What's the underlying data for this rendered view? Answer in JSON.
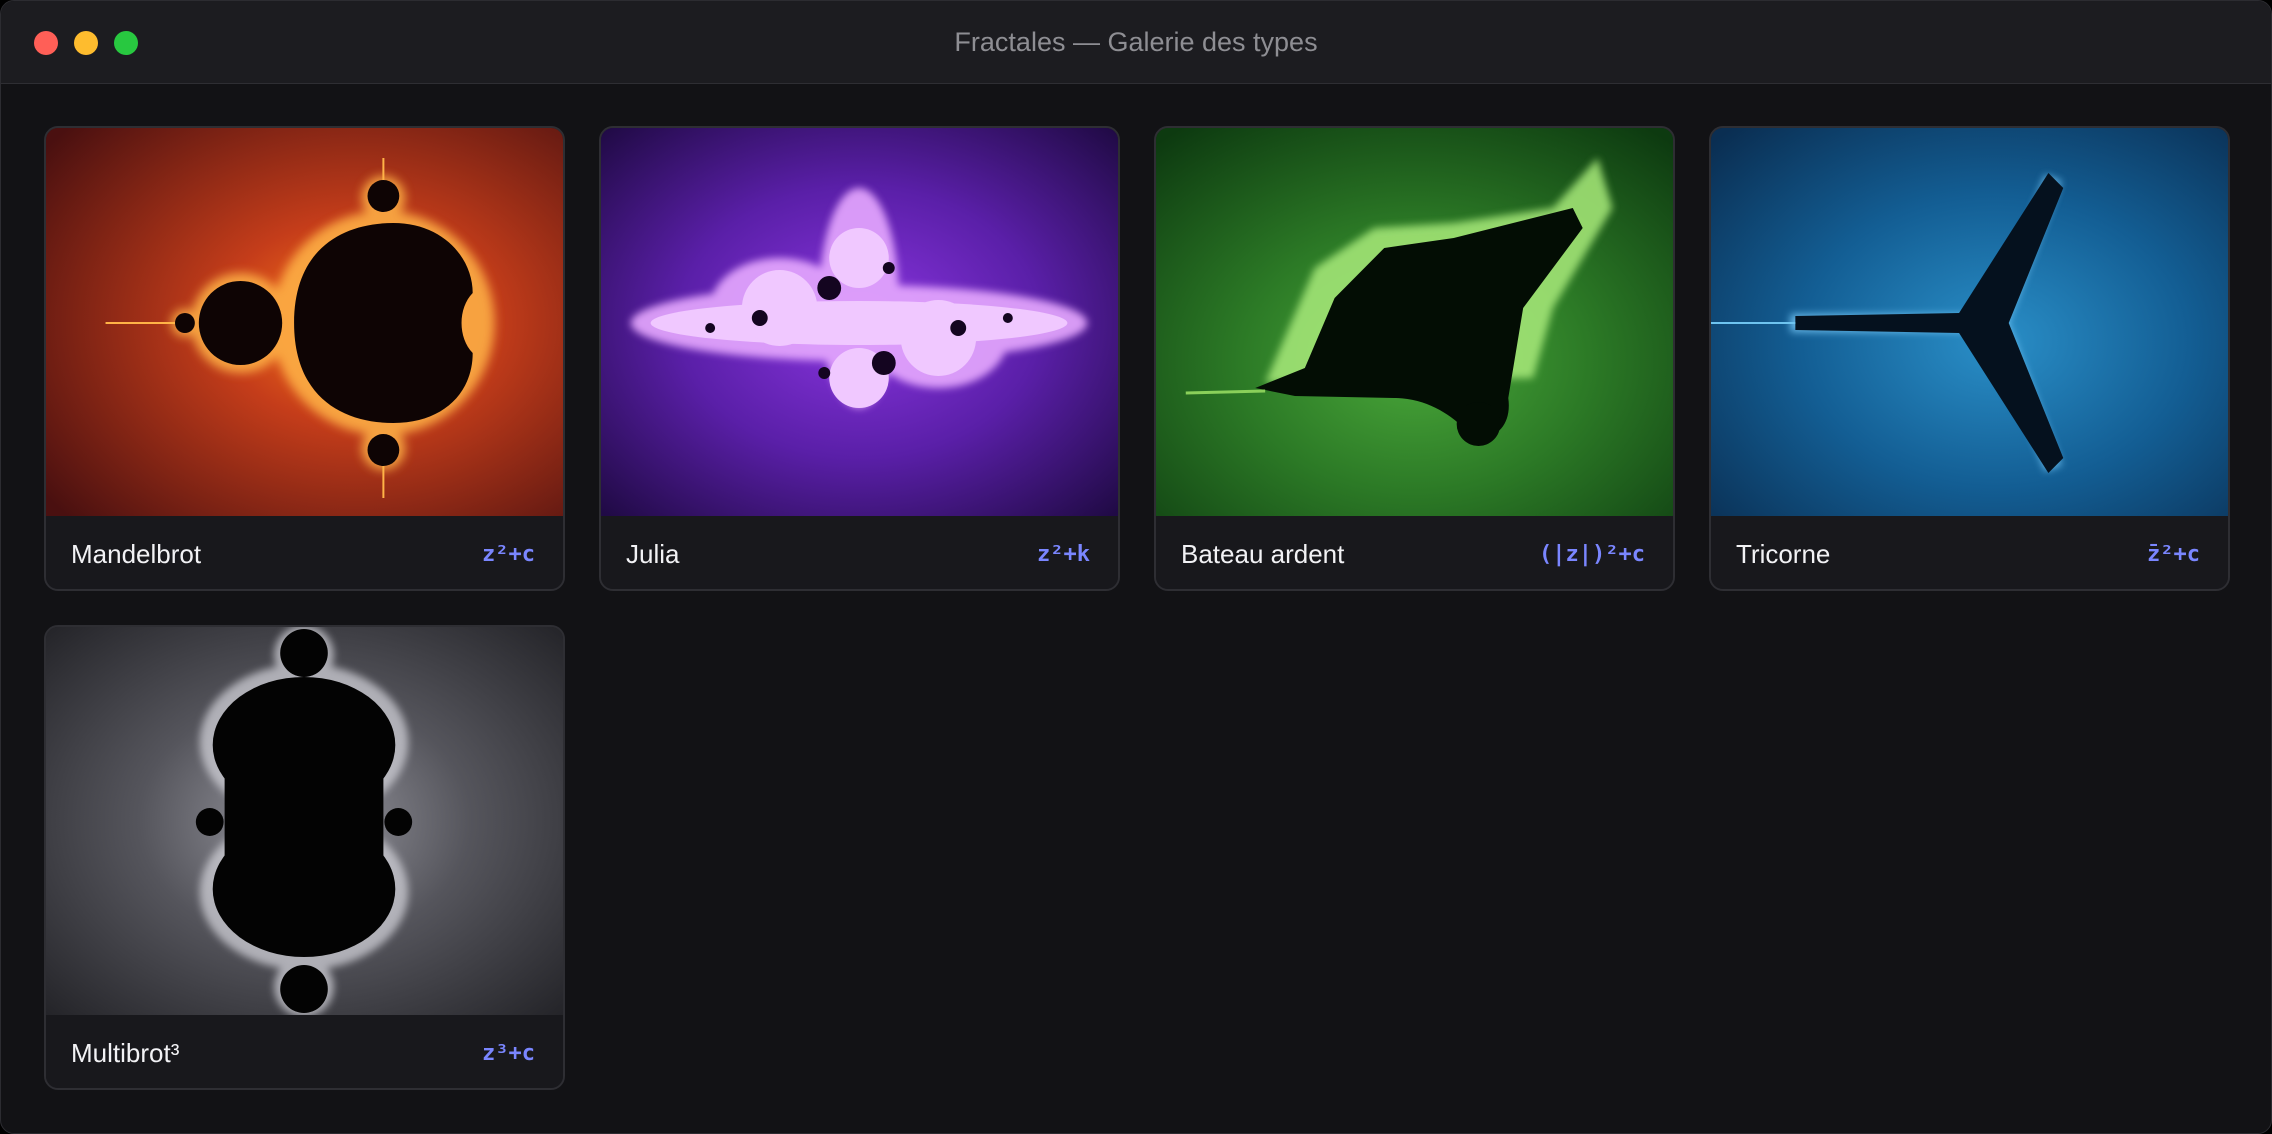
{
  "window": {
    "title": "Fractales — Galerie des types"
  },
  "cards": [
    {
      "name": "Mandelbrot",
      "formula": "z²+c",
      "thumbnail_icon": "mandelbrot-fractal-image",
      "accent": "#e8501a"
    },
    {
      "name": "Julia",
      "formula": "z²+k",
      "thumbnail_icon": "julia-fractal-image",
      "accent": "#9b3de6"
    },
    {
      "name": "Bateau ardent",
      "formula": "(|z|)²+c",
      "thumbnail_icon": "burning-ship-fractal-image",
      "accent": "#2f8a2a"
    },
    {
      "name": "Tricorne",
      "formula": "z̄²+c",
      "thumbnail_icon": "tricorn-fractal-image",
      "accent": "#1a6ea8"
    },
    {
      "name": "Multibrot³",
      "formula": "z³+c",
      "thumbnail_icon": "multibrot-fractal-image",
      "accent": "#9a9aa2"
    }
  ],
  "colors": {
    "background": "#121215",
    "titlebar": "#1c1c20",
    "formula": "#7a86ff",
    "close": "#ff5f57",
    "minimize": "#febc2e",
    "maximize": "#28c840"
  }
}
